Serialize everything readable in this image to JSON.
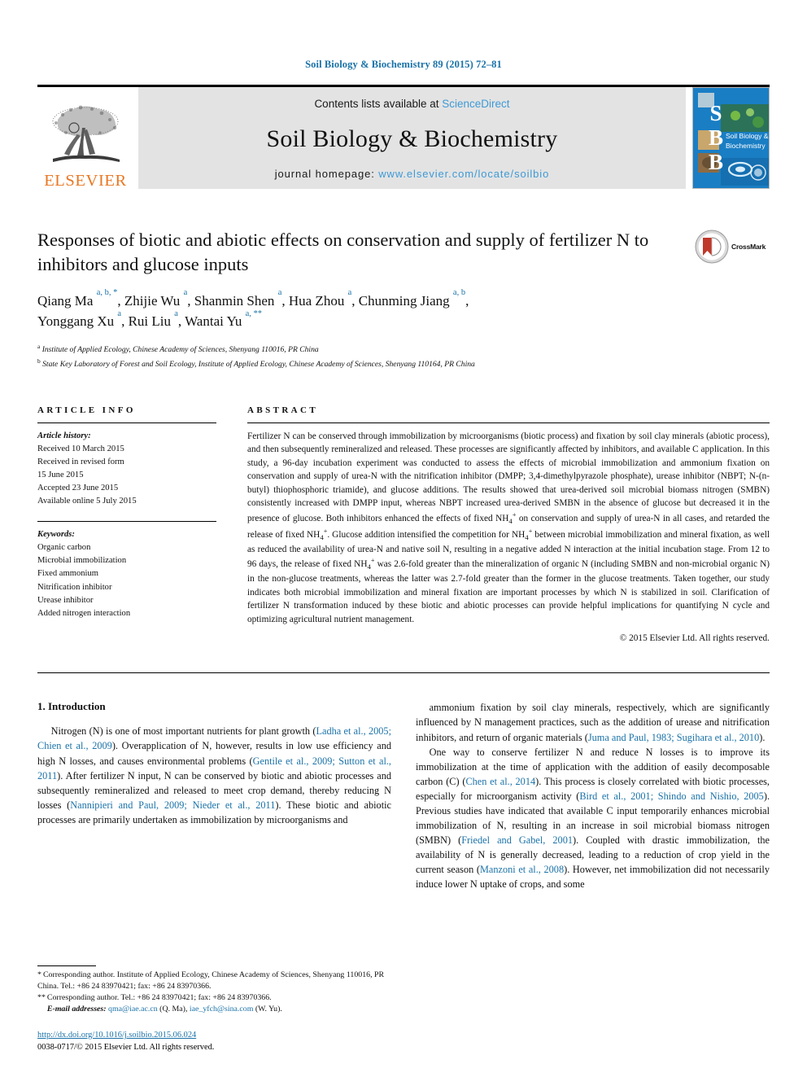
{
  "running_head": "Soil Biology & Biochemistry 89 (2015) 72–81",
  "masthead": {
    "publisher_name": "ELSEVIER",
    "contents_prefix": "Contents lists available at ",
    "contents_link": "ScienceDirect",
    "journal_name": "Soil Biology & Biochemistry",
    "homepage_prefix": "journal homepage: ",
    "homepage_url": "www.elsevier.com/locate/soilbio",
    "cover_title_line1": "Soil Biology &",
    "cover_title_line2": "Biochemistry",
    "cover_letters": [
      "S",
      "B",
      "B"
    ]
  },
  "article": {
    "title": "Responses of biotic and abiotic effects on conservation and supply of fertilizer N to inhibitors and glucose inputs",
    "crossmark_label": "CrossMark",
    "authors_line1": "Qiang Ma <sup>a, b, *</sup>, Zhijie Wu <sup>a</sup>, Shanmin Shen <sup>a</sup>, Hua Zhou <sup>a</sup>, Chunming Jiang <sup>a, b</sup>,",
    "authors_line2": "Yonggang Xu <sup>a</sup>, Rui Liu <sup>a</sup>, Wantai Yu <sup>a, **</sup>",
    "affiliation_a": "Institute of Applied Ecology, Chinese Academy of Sciences, Shenyang 110016, PR China",
    "affiliation_b": "State Key Laboratory of Forest and Soil Ecology, Institute of Applied Ecology, Chinese Academy of Sciences, Shenyang 110164, PR China"
  },
  "article_info": {
    "heading": "ARTICLE INFO",
    "history_label": "Article history:",
    "history": [
      "Received 10 March 2015",
      "Received in revised form",
      "15 June 2015",
      "Accepted 23 June 2015",
      "Available online 5 July 2015"
    ],
    "keywords_label": "Keywords:",
    "keywords": [
      "Organic carbon",
      "Microbial immobilization",
      "Fixed ammonium",
      "Nitrification inhibitor",
      "Urease inhibitor",
      "Added nitrogen interaction"
    ]
  },
  "abstract": {
    "heading": "ABSTRACT",
    "text": "Fertilizer N can be conserved through immobilization by microorganisms (biotic process) and fixation by soil clay minerals (abiotic process), and then subsequently remineralized and released. These processes are significantly affected by inhibitors, and available C application. In this study, a 96-day incubation experiment was conducted to assess the effects of microbial immobilization and ammonium fixation on conservation and supply of urea-N with the nitrification inhibitor (DMPP; 3,4-dimethylpyrazole phosphate), urease inhibitor (NBPT; N-(n-butyl) thiophosphoric triamide), and glucose additions. The results showed that urea-derived soil microbial biomass nitrogen (SMBN) consistently increased with DMPP input, whereas NBPT increased urea-derived SMBN in the absence of glucose but decreased it in the presence of glucose. Both inhibitors enhanced the effects of fixed NH4+ on conservation and supply of urea-N in all cases, and retarded the release of fixed NH4+. Glucose addition intensified the competition for NH4+ between microbial immobilization and mineral fixation, as well as reduced the availability of urea-N and native soil N, resulting in a negative added N interaction at the initial incubation stage. From 12 to 96 days, the release of fixed NH4+ was 2.6-fold greater than the mineralization of organic N (including SMBN and non-microbial organic N) in the non-glucose treatments, whereas the latter was 2.7-fold greater than the former in the glucose treatments. Taken together, our study indicates both microbial immobilization and mineral fixation are important processes by which N is stabilized in soil. Clarification of fertilizer N transformation induced by these biotic and abiotic processes can provide helpful implications for quantifying N cycle and optimizing agricultural nutrient management.",
    "copyright": "© 2015 Elsevier Ltd. All rights reserved."
  },
  "introduction": {
    "section_number_title": "1. Introduction",
    "left_paragraph_html": "Nitrogen (N) is one of most important nutrients for plant growth (<span class=\"ref\">Ladha et al., 2005; Chien et al., 2009</span>). Overapplication of N, however, results in low use efficiency and high N losses, and causes environmental problems (<span class=\"ref\">Gentile et al., 2009; Sutton et al., 2011</span>). After fertilizer N input, N can be conserved by biotic and abiotic processes and subsequently remineralized and released to meet crop demand, thereby reducing N losses (<span class=\"ref\">Nannipieri and Paul, 2009; Nieder et al., 2011</span>). These biotic and abiotic processes are primarily undertaken as immobilization by microorganisms and",
    "right_paragraph_1_html": "ammonium fixation by soil clay minerals, respectively, which are significantly influenced by N management practices, such as the addition of urease and nitrification inhibitors, and return of organic materials (<span class=\"ref\">Juma and Paul, 1983; Sugihara et al., 2010</span>).",
    "right_paragraph_2_html": "One way to conserve fertilizer N and reduce N losses is to improve its immobilization at the time of application with the addition of easily decomposable carbon (C) (<span class=\"ref\">Chen et al., 2014</span>). This process is closely correlated with biotic processes, especially for microorganism activity (<span class=\"ref\">Bird et al., 2001; Shindo and Nishio, 2005</span>). Previous studies have indicated that available C input temporarily enhances microbial immobilization of N, resulting in an increase in soil microbial biomass nitrogen (SMBN) (<span class=\"ref\">Friedel and Gabel, 2001</span>). Coupled with drastic immobilization, the availability of N is generally decreased, leading to a reduction of crop yield in the current season (<span class=\"ref\">Manzoni et al., 2008</span>). However, net immobilization did not necessarily induce lower N uptake of crops, and some"
  },
  "footnotes": {
    "corresponding_1": "Corresponding author. Institute of Applied Ecology, Chinese Academy of Sciences, Shenyang 110016, PR China. Tel.: +86 24 83970421; fax: +86 24 83970366.",
    "corresponding_2": "Corresponding author. Tel.: +86 24 83970421; fax: +86 24 83970366.",
    "email_label": "E-mail addresses:",
    "email_1": "qma@iae.ac.cn",
    "email_1_owner": "(Q. Ma),",
    "email_2": "iae_yfch@sina.com",
    "email_2_owner": "(W. Yu).",
    "doi_url": "http://dx.doi.org/10.1016/j.soilbio.2015.06.024",
    "issn_line": "0038-0717/© 2015 Elsevier Ltd. All rights reserved."
  },
  "colors": {
    "link_blue": "#1a72a8",
    "sciencedirect_blue": "#3e9ad6",
    "elsevier_orange": "#E87722",
    "masthead_gray": "#e3e3e3",
    "cover_blue": "#1a7ec4"
  }
}
